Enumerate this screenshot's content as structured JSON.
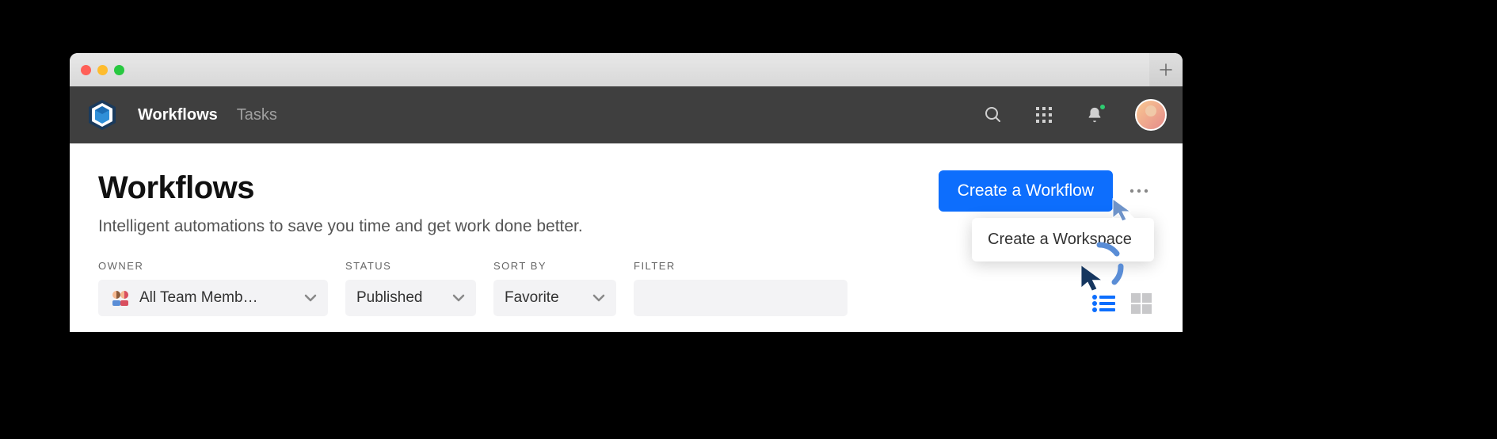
{
  "nav": {
    "items": [
      "Workflows",
      "Tasks"
    ],
    "active": "Workflows"
  },
  "page": {
    "title": "Workflows",
    "subtitle": "Intelligent automations to save you time and get work done better."
  },
  "actions": {
    "primary": "Create a Workflow",
    "menu_item": "Create a Workspace"
  },
  "filters": {
    "owner": {
      "label": "OWNER",
      "value": "All Team Memb…"
    },
    "status": {
      "label": "STATUS",
      "value": "Published"
    },
    "sort": {
      "label": "SORT BY",
      "value": "Favorite"
    },
    "filter": {
      "label": "FILTER",
      "value": ""
    }
  }
}
